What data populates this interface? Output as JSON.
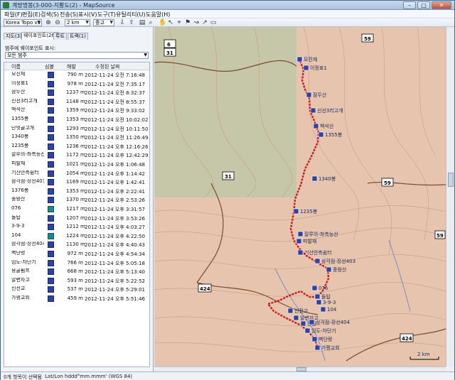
{
  "window": {
    "title": "계방명봉(3-000-지황도(2) - MapSource",
    "min_label": "–",
    "max_label": "□",
    "close_label": "✕"
  },
  "menu": [
    "파일(F)",
    "편집(E)",
    "검색(S)",
    "전송(S)",
    "표시(V)",
    "도구(T)",
    "유틸리티(U)",
    "도움말(H)"
  ],
  "toolbar": {
    "map_product": "Korea Topo v9",
    "zoom_value": "2 km",
    "detail_value": "중고"
  },
  "tabs": [
    "지도(3)",
    "웨이포인트(26)",
    "루트",
    "트랙(1)"
  ],
  "filter": {
    "label": "범주에 웨이포인트 표시:",
    "value": "모든 범주"
  },
  "list": {
    "headers": [
      "이름",
      "심볼",
      "해발",
      "수정된 날짜"
    ],
    "rows": [
      {
        "name": "모진재",
        "symbol": "hiker",
        "elev": "790 m",
        "date": "2012-11-24 오전 7:16:48"
      },
      {
        "name": "이정표1",
        "symbol": "hiker",
        "elev": "978 m",
        "date": "2012-11-24 오전 7:35:17"
      },
      {
        "name": "잠두산",
        "symbol": "hiker",
        "elev": "1237 m",
        "date": "2012-11-24 오전 8:32:37"
      },
      {
        "name": "신선3리고개",
        "symbol": "hiker",
        "elev": "1148 m",
        "date": "2012-11-24 오전 8:55:37"
      },
      {
        "name": "백석산",
        "symbol": "hiker",
        "elev": "1359 m",
        "date": "2012-11-24 오전 9:33:02"
      },
      {
        "name": "1355봉",
        "symbol": "hiker",
        "elev": "1353 m",
        "date": "2012-11-24 오전 10:02:02"
      },
      {
        "name": "단엇골고개",
        "symbol": "hiker",
        "elev": "1293 m",
        "date": "2012-11-24 오전 10:11:50"
      },
      {
        "name": "1340봉",
        "symbol": "hiker",
        "elev": "1350 m",
        "date": "2012-11-24 오전 11:26:49"
      },
      {
        "name": "1235봉",
        "symbol": "hiker",
        "elev": "1236 m",
        "date": "2012-11-24 오후 12:16:26"
      },
      {
        "name": "잘루의-좌측능선",
        "symbol": "hiker",
        "elev": "1172 m",
        "date": "2012-11-24 오후 12:42:29"
      },
      {
        "name": "피발재",
        "symbol": "hiker",
        "elev": "1021 m",
        "date": "2012-11-24 오후 1:06:48"
      },
      {
        "name": "기산안측쉼터",
        "symbol": "hiker",
        "elev": "1054 m",
        "date": "2012-11-24 오후 1:14:42"
      },
      {
        "name": "삼각점-장선403",
        "symbol": "hiker",
        "elev": "1169 m",
        "date": "2012-11-24 오후 1:42:41"
      },
      {
        "name": "1376봉",
        "symbol": "hiker",
        "elev": "1353 m",
        "date": "2012-11-24 오후 2:22:41"
      },
      {
        "name": "중왕산",
        "symbol": "hiker",
        "elev": "1370 m",
        "date": "2012-11-24 오후 2:53:26"
      },
      {
        "name": "076",
        "symbol": "flag",
        "elev": "1217 m",
        "date": "2012-11-24 오후 3:31:57"
      },
      {
        "name": "돌탑",
        "symbol": "hiker",
        "elev": "1207 m",
        "date": "2012-11-24 오후 3:53:26"
      },
      {
        "name": "3-9-3",
        "symbol": "hiker",
        "elev": "1212 m",
        "date": "2012-11-24 오후 4:03:27"
      },
      {
        "name": "104",
        "symbol": "flag",
        "elev": "1224 m",
        "date": "2012-11-24 오후 4:22:50"
      },
      {
        "name": "삼각점-장선404",
        "symbol": "hiker",
        "elev": "1130 m",
        "date": "2012-11-24 오후 4:40:43"
      },
      {
        "name": "벽단령",
        "symbol": "hiker",
        "elev": "972 m",
        "date": "2012-11-24 오후 4:54:34"
      },
      {
        "name": "임도-차단기",
        "symbol": "hiker",
        "elev": "766 m",
        "date": "2012-11-24 오후 5:05:18"
      },
      {
        "name": "웅골펌프",
        "symbol": "hiker",
        "elev": "668 m",
        "date": "2012-11-24 오후 5:13:40"
      },
      {
        "name": "알변자고",
        "symbol": "hiker",
        "elev": "593 m",
        "date": "2012-11-24 오후 5:22:52"
      },
      {
        "name": "신전교",
        "symbol": "hiker",
        "elev": "537 m",
        "date": "2012-11-24 오후 5:29:01"
      },
      {
        "name": "가평교회",
        "symbol": "hiker",
        "elev": "459 m",
        "date": "2012-11-24 오후 5:51:46"
      }
    ]
  },
  "map": {
    "road_shields": [
      "6",
      "31",
      "31",
      "59",
      "59",
      "59",
      "424",
      "424"
    ],
    "route_color": "#d11a1a",
    "labels": [
      "모진재",
      "이정표1",
      "잠두산",
      "신선3리고개",
      "백석산",
      "1355봉",
      "1340봉",
      "1235봉",
      "잘루의-좌측능선",
      "피발재",
      "기산안측쉼터",
      "삼각점-장선403",
      "중왕산",
      "076",
      "돌탑",
      "3-9-3",
      "104",
      "신전교",
      "알변자고",
      "웅골",
      "삼각점-장선404",
      "임도-차단기",
      "벽단령",
      "가평교회"
    ],
    "scale": "2 km"
  },
  "status": {
    "selection": "0개 항목이 선택됨",
    "coord_format": "Lat/Lon hddd°mm.mmm' (WGS 84)"
  }
}
